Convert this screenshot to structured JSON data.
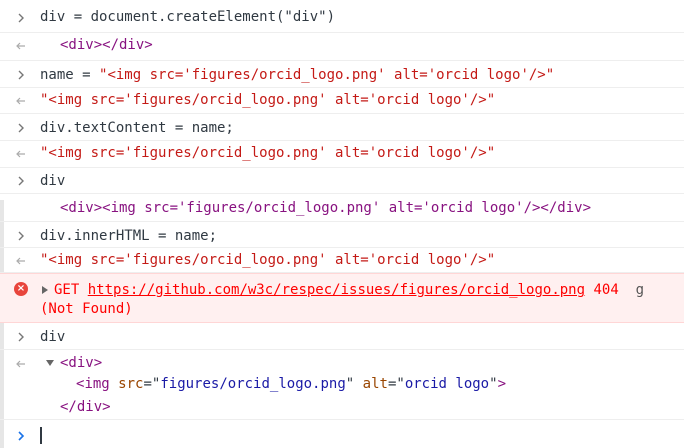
{
  "entries": [
    {
      "kind": "input",
      "text": "div = document.createElement(\"div\")"
    },
    {
      "kind": "output",
      "text": "<div></div>"
    },
    {
      "kind": "input",
      "text": "name = \"<img src='figures/orcid_logo.png' alt='orcid logo'/>\""
    },
    {
      "kind": "output",
      "text": "\"<img src='figures/orcid_logo.png' alt='orcid logo'/>\""
    },
    {
      "kind": "input",
      "text": "div.textContent = name;"
    },
    {
      "kind": "output",
      "text": "\"<img src='figures/orcid_logo.png' alt='orcid logo'/>\""
    },
    {
      "kind": "input",
      "text": "div"
    },
    {
      "kind": "output",
      "text": "<div><img src='figures/orcid_logo.png' alt='orcid logo'/></div>"
    },
    {
      "kind": "input",
      "text": "div.innerHTML = name;"
    },
    {
      "kind": "output",
      "text": "\"<img src='figures/orcid_logo.png' alt='orcid logo'/>\""
    }
  ],
  "error": {
    "method": "GET",
    "url": "https://github.com/w3c/respec/issues/figures/orcid_logo.png",
    "status": "404",
    "status_text": "(Not Found)",
    "cut_char": "g"
  },
  "tree": {
    "input": "div",
    "open_tag": "<div>",
    "child_tag": "img",
    "src_attr": "src",
    "src_value": "figures/orcid_logo.png",
    "alt_attr": "alt",
    "alt_value": "orcid logo",
    "close_tag": "</div>"
  },
  "colors": {
    "tag": "#881280",
    "string": "#c41a16",
    "attr_name": "#994500",
    "attr_value": "#1a1aa6",
    "error": "#ff0000",
    "error_bg": "#fff0f0",
    "prompt": "#1a73e8"
  },
  "icons": {
    "input_prompt": "chevron-right-icon",
    "output_marker": "return-arrow-icon",
    "error": "error-circle-icon",
    "expand": "triangle-right-icon",
    "collapse": "triangle-down-icon"
  }
}
